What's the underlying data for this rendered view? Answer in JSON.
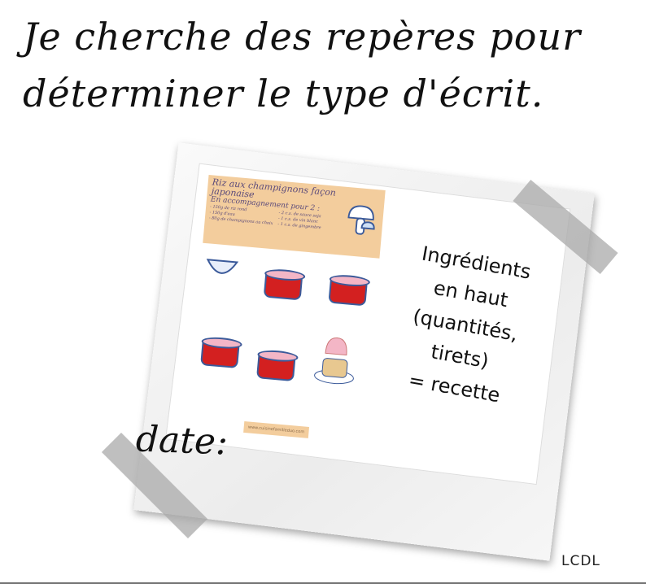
{
  "title": {
    "line1": "Je cherche des repères pour",
    "line2": "déterminer le type d'écrit."
  },
  "recipe": {
    "title": "Riz aux champignons façon japonaise",
    "subtitle": "En accompagnement pour 2 :",
    "ingredients": [
      "- 150g de riz rond",
      "- 150g d'eau",
      "- 80g de champignons au choix",
      "- 2 c.s. de sauce soja",
      "- 1 c.s. de vin blanc",
      "- 1 c.s. de gingembre"
    ],
    "footer": "www.cuisinefamilleduo.com"
  },
  "caption": [
    "Ingrédients",
    "en haut",
    "(quantités,",
    "tirets)",
    "= recette"
  ],
  "date_label": "date:",
  "credit": "LCDL",
  "colors": {
    "recipe_header": "#f3cd9d",
    "tape": "#aaaaaa",
    "pot": "#d32020"
  }
}
